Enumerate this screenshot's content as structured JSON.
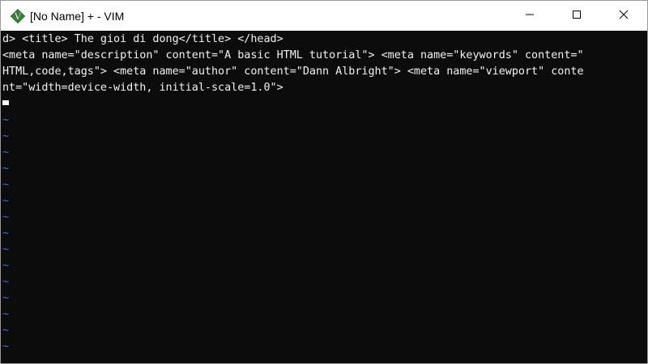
{
  "window": {
    "title": "[No Name] + - VIM",
    "app_icon": "vim-icon",
    "controls": [
      "minimize-icon",
      "maximize-icon",
      "close-icon"
    ]
  },
  "editor": {
    "lines": [
      "d> <title> The gioi di dong</title> </head>",
      "<meta name=\"description\" content=\"A basic HTML tutorial\"> <meta name=\"keywords\" content=\"",
      "HTML,code,tags\"> <meta name=\"author\" content=\"Dann Albright\"> <meta name=\"viewport\" conte",
      "nt=\"width=device-width, initial-scale=1.0\">"
    ],
    "empty_line_marker": "~",
    "empty_line_count": 15,
    "colors": {
      "background": "#0c0c0c",
      "text": "#f2f2f2",
      "tilde": "#4a6fd6",
      "cursor": "#ffffff"
    }
  }
}
